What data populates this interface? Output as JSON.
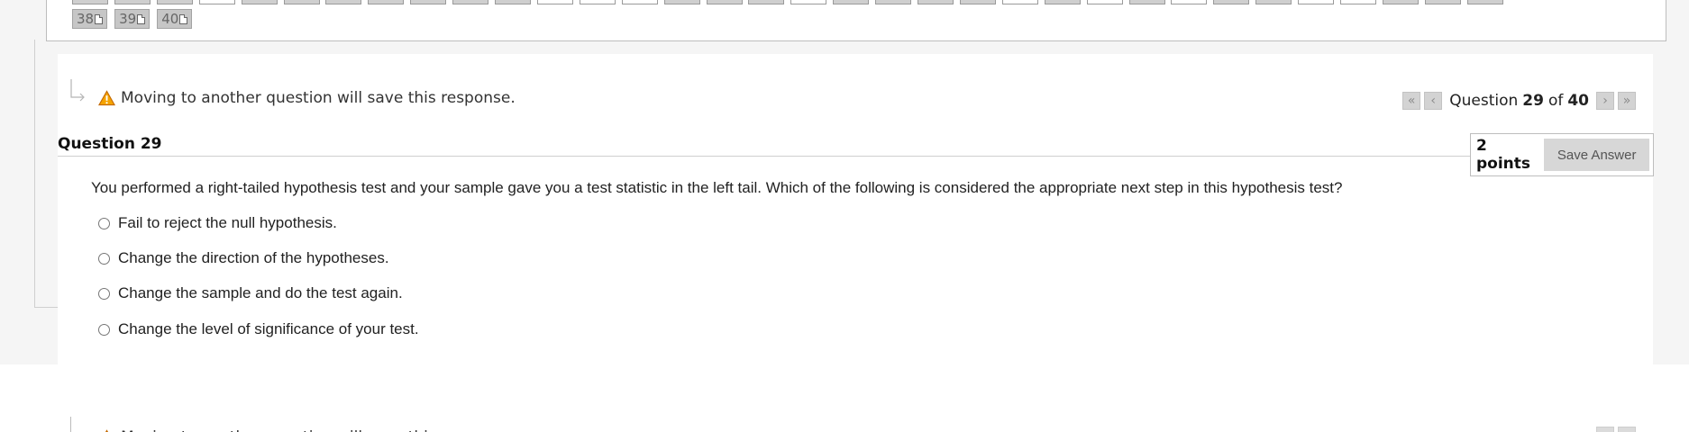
{
  "question_nav": {
    "top_row_boxes": 34,
    "chips": [
      {
        "number": "38",
        "icon": "document-icon"
      },
      {
        "number": "39",
        "icon": "document-icon"
      },
      {
        "number": "40",
        "icon": "document-icon"
      }
    ]
  },
  "warning": {
    "icon": "warning-icon",
    "text": "Moving to another question will save this response."
  },
  "pager": {
    "first_icon": "«",
    "prev_icon": "‹",
    "label_prefix": "Question",
    "current": "29",
    "of_text": "of",
    "total": "40",
    "next_icon": "›",
    "last_icon": "»"
  },
  "question": {
    "title": "Question 29",
    "points": "2 points",
    "save_label": "Save Answer",
    "text": "You performed a right-tailed hypothesis test and your sample gave you a test statistic in the left tail. Which of the following is considered the appropriate next step in this hypothesis test?",
    "options": [
      "Fail to reject the null hypothesis.",
      "Change the direction of the hypotheses.",
      "Change the sample and do the test again.",
      "Change the level of significance of your test."
    ]
  },
  "colors": {
    "warning_fill": "#f5a300",
    "chip_bg": "#c6c6c6",
    "save_button_bg": "#d7d7d7"
  }
}
